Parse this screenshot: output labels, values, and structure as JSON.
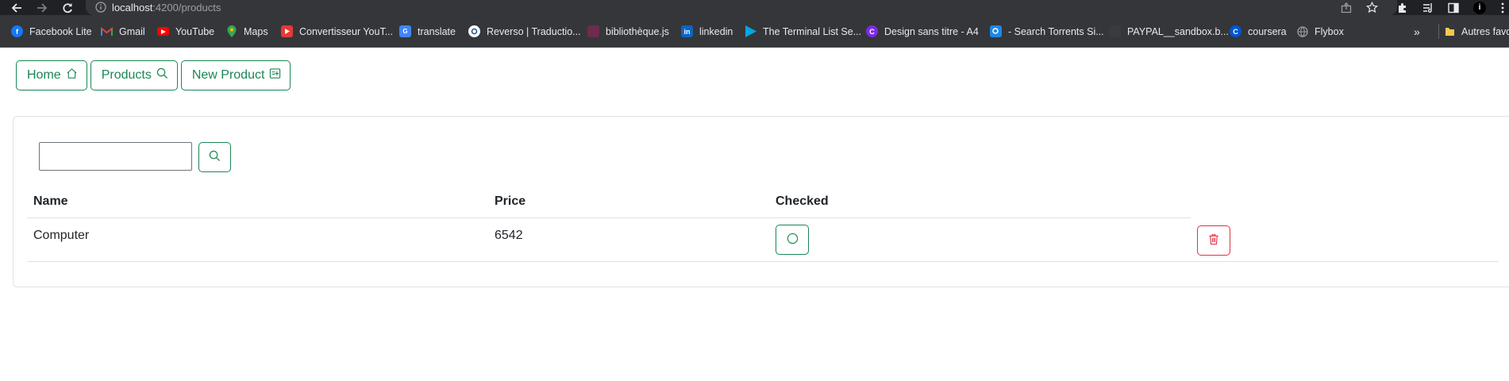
{
  "browser": {
    "url_host": "localhost",
    "url_path": ":4200/products",
    "bookmarks": [
      {
        "label": "Facebook Lite",
        "icon": "facebook-icon",
        "color": "#1877f2"
      },
      {
        "label": "Gmail",
        "icon": "gmail-icon",
        "color": "#ea4335"
      },
      {
        "label": "YouTube",
        "icon": "youtube-icon",
        "color": "#ff0000"
      },
      {
        "label": "Maps",
        "icon": "maps-pin-icon",
        "color": "#34a853"
      },
      {
        "label": "Convertisseur YouT...",
        "icon": "converter-icon",
        "color": "#e53935"
      },
      {
        "label": "translate",
        "icon": "google-translate-icon",
        "color": "#4285f4"
      },
      {
        "label": "Reverso | Traductio...",
        "icon": "reverso-icon",
        "color": "#ffffff"
      },
      {
        "label": "bibliothèque.js",
        "icon": "bibliotheque-icon",
        "color": "#6d2c4d"
      },
      {
        "label": "linkedin",
        "icon": "linkedin-icon",
        "color": "#0a66c2"
      },
      {
        "label": "The Terminal List Se...",
        "icon": "prime-video-icon",
        "color": "#00a8e1"
      },
      {
        "label": "Design sans titre - A4",
        "icon": "canva-icon",
        "color": "#7d2ae8"
      },
      {
        "label": "- Search Torrents Si...",
        "icon": "torrents-icon",
        "color": "#1e88e5"
      },
      {
        "label": "PAYPAL__sandbox.b...",
        "icon": "paypal-icon",
        "color": "#3a3b3e"
      },
      {
        "label": "coursera",
        "icon": "coursera-icon",
        "color": "#0056d2"
      },
      {
        "label": "Flybox",
        "icon": "globe-icon",
        "color": "#9aa0a6"
      }
    ],
    "more_bookmarks": "»",
    "other_bookmarks": "Autres favoris",
    "profile_initial": "i"
  },
  "app": {
    "nav": [
      {
        "label": "Home",
        "icon": "house-icon"
      },
      {
        "label": "Products",
        "icon": "search-icon"
      },
      {
        "label": "New Product",
        "icon": "new-product-icon"
      }
    ],
    "search": {
      "value": "",
      "button_icon": "search-icon"
    },
    "table": {
      "headers": [
        "Name",
        "Price",
        "Checked"
      ],
      "rows": [
        {
          "name": "Computer",
          "price": "6542",
          "checked": false
        }
      ]
    },
    "colors": {
      "success": "#198754",
      "danger": "#dc3545",
      "border": "#dee2e6"
    }
  }
}
